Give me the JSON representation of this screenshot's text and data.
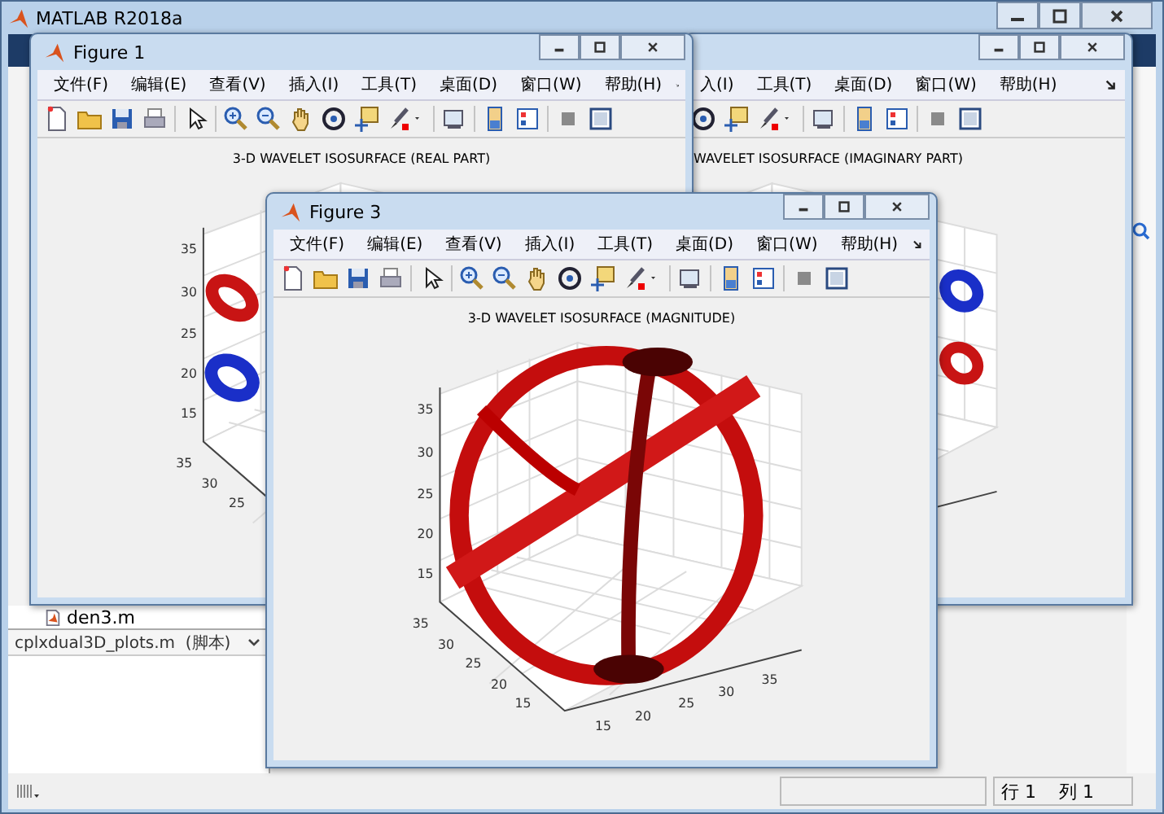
{
  "window": {
    "title": "MATLAB R2018a"
  },
  "file_browser": {
    "current_file": "den3.m",
    "details_title": "cplxdual3D_plots.m  (脚本)"
  },
  "figures": [
    {
      "kind": "real",
      "title": "Figure 1",
      "menu": [
        "文件(F)",
        "编辑(E)",
        "查看(V)",
        "插入(I)",
        "工具(T)",
        "桌面(D)",
        "窗口(W)",
        "帮助(H)"
      ],
      "plot_title": "3-D WAVELET ISOSURFACE (REAL PART)",
      "z_ticks": [
        "35",
        "30",
        "25",
        "20",
        "15"
      ],
      "y_ticks": [
        "35",
        "30",
        "25"
      ]
    },
    {
      "kind": "imaginary",
      "menu": [
        "入(I)",
        "工具(T)",
        "桌面(D)",
        "窗口(W)",
        "帮助(H)"
      ],
      "plot_title": "WAVELET ISOSURFACE (IMAGINARY PART)"
    },
    {
      "kind": "magnitude",
      "title": "Figure 3",
      "menu": [
        "文件(F)",
        "编辑(E)",
        "查看(V)",
        "插入(I)",
        "工具(T)",
        "桌面(D)",
        "窗口(W)",
        "帮助(H)"
      ],
      "plot_title": "3-D WAVELET ISOSURFACE (MAGNITUDE)",
      "z_ticks": [
        "35",
        "30",
        "25",
        "20",
        "15"
      ],
      "y_ticks": [
        "35",
        "30",
        "25",
        "20",
        "15"
      ],
      "x_ticks": [
        "15",
        "20",
        "25",
        "30",
        "35"
      ]
    }
  ],
  "status_bar": {
    "line": "行 1",
    "column": "列 1"
  }
}
